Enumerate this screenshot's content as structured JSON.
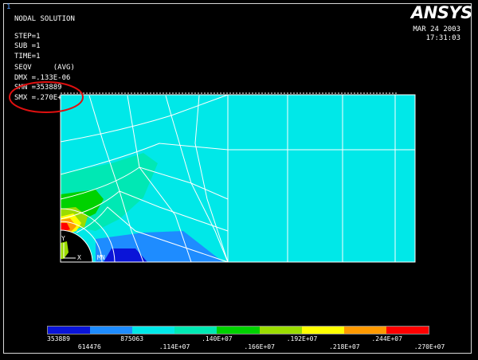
{
  "window": {
    "number": "1"
  },
  "header": {
    "title": "NODAL SOLUTION",
    "step": "STEP=1",
    "sub": "SUB =1",
    "time": "TIME=1",
    "seqv": "SEQV     (AVG)",
    "dmx": "DMX =.133E-06",
    "smn": "SMN =353889",
    "smx": "SMX =.270E+07"
  },
  "logo": {
    "text": "ANSYS"
  },
  "datetime": {
    "date": "MAR 24 2003",
    "time": "17:31:03"
  },
  "plot": {
    "axis_y": "Y",
    "axis_x": "X",
    "mn_label": "MN"
  },
  "legend": {
    "colors": [
      "#0a14d8",
      "#1e8cff",
      "#00e8e8",
      "#00e8b4",
      "#00d200",
      "#9bdc00",
      "#ffff00",
      "#ff9a00",
      "#ff0000"
    ],
    "labels_top": [
      "353889",
      "875063",
      ".140E+07",
      ".192E+07",
      ".244E+07"
    ],
    "labels_bottom": [
      "614476",
      ".114E+07",
      ".166E+07",
      ".218E+07",
      ".270E+07"
    ]
  },
  "annotation": {
    "color": "#e01010"
  }
}
